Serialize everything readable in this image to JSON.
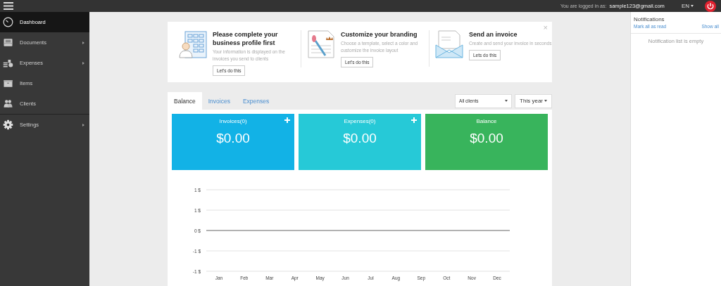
{
  "top_bar": {
    "login_label": "You are logged in as:",
    "email": "sample123@gmail.com",
    "language": "EN"
  },
  "sidebar": {
    "sections": [
      {
        "items": [
          {
            "label": "Dashboard",
            "kind": "gauge",
            "selected": true,
            "has_submenu": false
          },
          {
            "label": "Documents",
            "kind": "tray",
            "selected": false,
            "has_submenu": true
          },
          {
            "label": "Expenses",
            "kind": "coins",
            "selected": false,
            "has_submenu": true
          },
          {
            "label": "Items",
            "kind": "box",
            "selected": false,
            "has_submenu": false
          },
          {
            "label": "Clients",
            "kind": "people",
            "selected": false,
            "has_submenu": false
          }
        ]
      },
      {
        "items": [
          {
            "label": "Settings",
            "kind": "gear",
            "selected": false,
            "has_submenu": true
          }
        ]
      }
    ]
  },
  "onboarding": {
    "close": "×",
    "steps": [
      {
        "kind": "building",
        "title": "Please complete your business profile first",
        "description": "Your information is displayed on the invoices you send to clients",
        "button": "Let's do this"
      },
      {
        "kind": "brush",
        "title": "Customize your branding",
        "description": "Choose a template, select a color and customize the invoice layout",
        "button": "Let's do this"
      },
      {
        "kind": "envelope",
        "title": "Send an invoice",
        "description": "Create and send your invoice in seconds",
        "button": "Lets do this"
      }
    ]
  },
  "tabs": [
    {
      "label": "Balance",
      "selected": true
    },
    {
      "label": "Invoices",
      "selected": false
    },
    {
      "label": "Expenses",
      "selected": false
    }
  ],
  "filters": {
    "client": "All clients",
    "period": "This year"
  },
  "stat_cards": [
    {
      "title": "Invoices(0)",
      "amount": "$0.00",
      "color": "#12b2e6",
      "addable": true
    },
    {
      "title": "Expenses(0)",
      "amount": "$0.00",
      "color": "#26c9d7",
      "addable": true
    },
    {
      "title": "Balance",
      "amount": "$0.00",
      "color": "#38b45c",
      "addable": false
    }
  ],
  "chart_data": {
    "type": "line",
    "categories": [
      "Jan",
      "Feb",
      "Mar",
      "Apr",
      "May",
      "Jun",
      "Jul",
      "Aug",
      "Sep",
      "Oct",
      "Nov",
      "Dec"
    ],
    "ylim": [
      -1,
      1
    ],
    "yticks": [
      {
        "value": 1,
        "label": "1 $"
      },
      {
        "value": 0.5,
        "label": "1 $"
      },
      {
        "value": 0,
        "label": "0 $"
      },
      {
        "value": -0.5,
        "label": "-1 $"
      },
      {
        "value": -1,
        "label": "-1 $"
      }
    ]
  },
  "notifications": {
    "title": "Notifications",
    "mark_all": "Mark all as read",
    "show_all": "Show all",
    "empty_message": "Notification list is empty"
  }
}
